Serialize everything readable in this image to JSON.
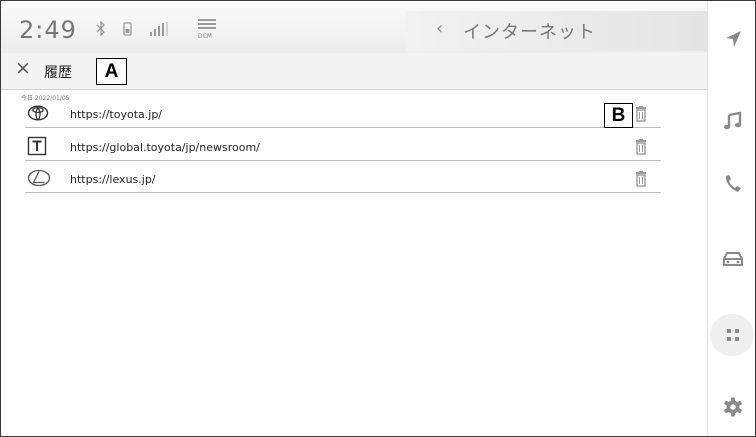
{
  "status_bar": {
    "time": "2:49",
    "bluetooth_icon": "bluetooth-icon",
    "phone_icon": "phone-status-icon",
    "signal_icon": "signal-strength-icon",
    "dcm_label": "DCM"
  },
  "title_bar": {
    "back_symbol": "‹",
    "title": "インターネット"
  },
  "header": {
    "close_symbol": "×",
    "title": "履歴",
    "callout_a": "A"
  },
  "history": {
    "date_label": "今日 2022/01/05",
    "callout_b": "B",
    "items": [
      {
        "icon": "toyota-logo-icon",
        "url": "https://toyota.jp/"
      },
      {
        "icon": "t-letter-icon",
        "icon_text": "T",
        "url": "https://global.toyota/jp/newsroom/"
      },
      {
        "icon": "lexus-logo-icon",
        "url": "https://lexus.jp/"
      }
    ]
  },
  "sidebar": {
    "items": [
      "navigation-arrow-icon",
      "music-note-icon",
      "phone-icon",
      "car-icon",
      "apps-grid-icon",
      "settings-gear-icon"
    ]
  },
  "colors": {
    "icon_gray": "#8a8a8a",
    "divider": "#bcbcbc",
    "header_bg": "#f3f3f3"
  }
}
